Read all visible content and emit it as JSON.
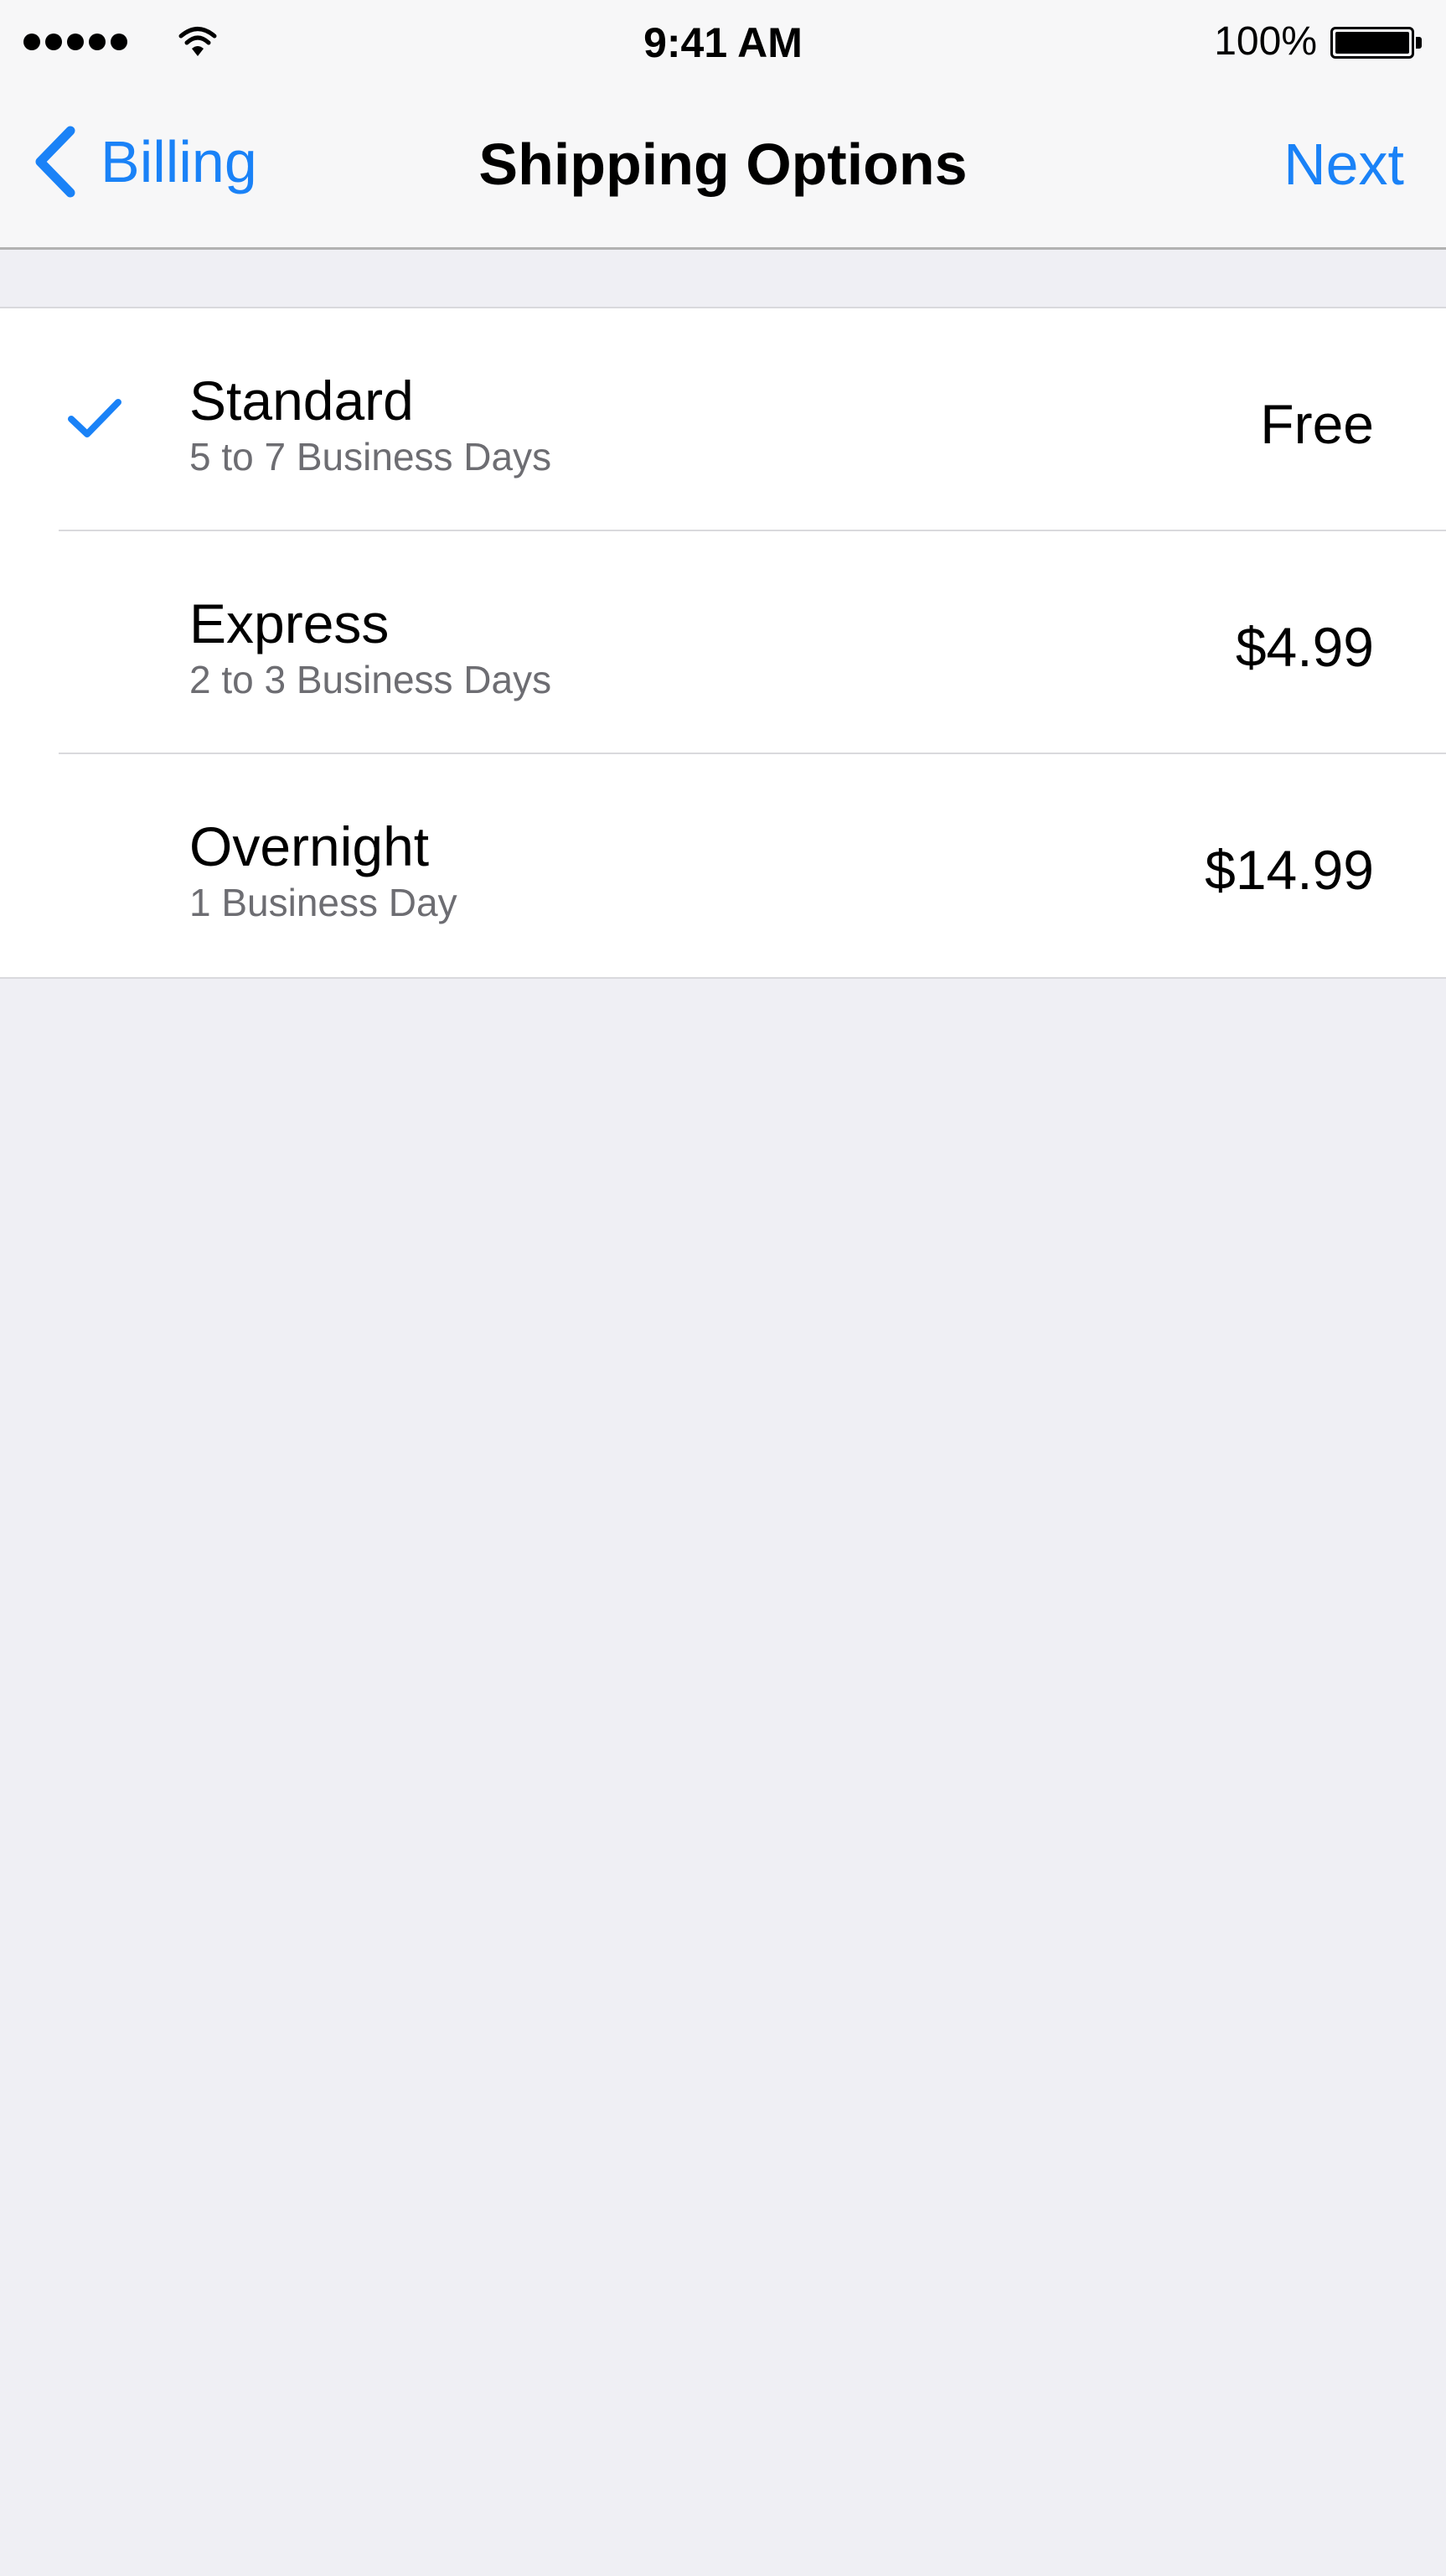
{
  "status_bar": {
    "time": "9:41 AM",
    "battery_percent": "100%",
    "signal_bars": 5,
    "battery_level": 1.0
  },
  "nav_bar": {
    "back_label": "Billing",
    "title": "Shipping Options",
    "next_label": "Next"
  },
  "colors": {
    "accent": "#1a82f7",
    "background": "#efeff4",
    "secondary_text": "#6d6d72"
  },
  "options": [
    {
      "name": "Standard",
      "detail": "5 to 7 Business Days",
      "price": "Free",
      "selected": true
    },
    {
      "name": "Express",
      "detail": "2 to 3 Business Days",
      "price": "$4.99",
      "selected": false
    },
    {
      "name": "Overnight",
      "detail": "1 Business Day",
      "price": "$14.99",
      "selected": false
    }
  ]
}
